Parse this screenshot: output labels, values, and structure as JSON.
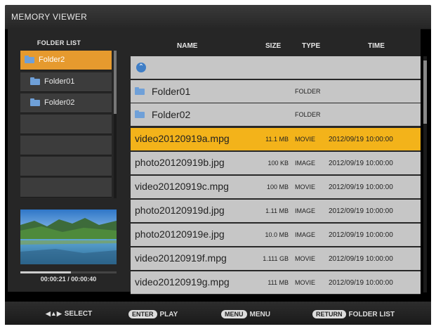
{
  "window": {
    "title": "MEMORY VIEWER"
  },
  "folder_list": {
    "header": "FOLDER LIST",
    "items": [
      {
        "label": "Folder2",
        "selected": true
      },
      {
        "label": "Folder01",
        "selected": false
      },
      {
        "label": "Folder02",
        "selected": false
      }
    ]
  },
  "preview": {
    "time": "00:00:21 / 00:00:40",
    "progress": 0.525
  },
  "file_list": {
    "columns": {
      "name": "NAME",
      "size": "SIZE",
      "type": "TYPE",
      "time": "TIME"
    },
    "folders": [
      {
        "name": "Folder01",
        "type": "FOLDER"
      },
      {
        "name": "Folder02",
        "type": "FOLDER"
      }
    ],
    "files": [
      {
        "name": "video20120919a.mpg",
        "size": "11.1 MB",
        "type": "MOVIE",
        "time": "2012/09/19 10:00:00",
        "selected": true
      },
      {
        "name": "photo20120919b.jpg",
        "size": "100 KB",
        "type": "IMAGE",
        "time": "2012/09/19 10:00:00"
      },
      {
        "name": "video20120919c.mpg",
        "size": "100 MB",
        "type": "MOVIE",
        "time": "2012/09/19 10:00:00"
      },
      {
        "name": "photo20120919d.jpg",
        "size": "1.11 MB",
        "type": "IMAGE",
        "time": "2012/09/19 10:00:00"
      },
      {
        "name": "photo20120919e.jpg",
        "size": "10.0 MB",
        "type": "IMAGE",
        "time": "2012/09/19 10:00:00"
      },
      {
        "name": "video20120919f.mpg",
        "size": "1.111 GB",
        "type": "MOVIE",
        "time": "2012/09/19 10:00:00"
      },
      {
        "name": "video20120919g.mpg",
        "size": "111 MB",
        "type": "MOVIE",
        "time": "2012/09/19 10:00:00"
      }
    ]
  },
  "footer": {
    "select": "SELECT",
    "enter_key": "ENTER",
    "enter_action": "PLAY",
    "menu_key": "MENU",
    "menu_action": "MENU",
    "return_key": "RETURN",
    "return_action": "FOLDER LIST"
  },
  "colors": {
    "selected_folder": "#e69a2e",
    "selected_file": "#f3b31a",
    "row_bg": "#c6c6c6",
    "folder_icon": "#6fa0d8"
  }
}
